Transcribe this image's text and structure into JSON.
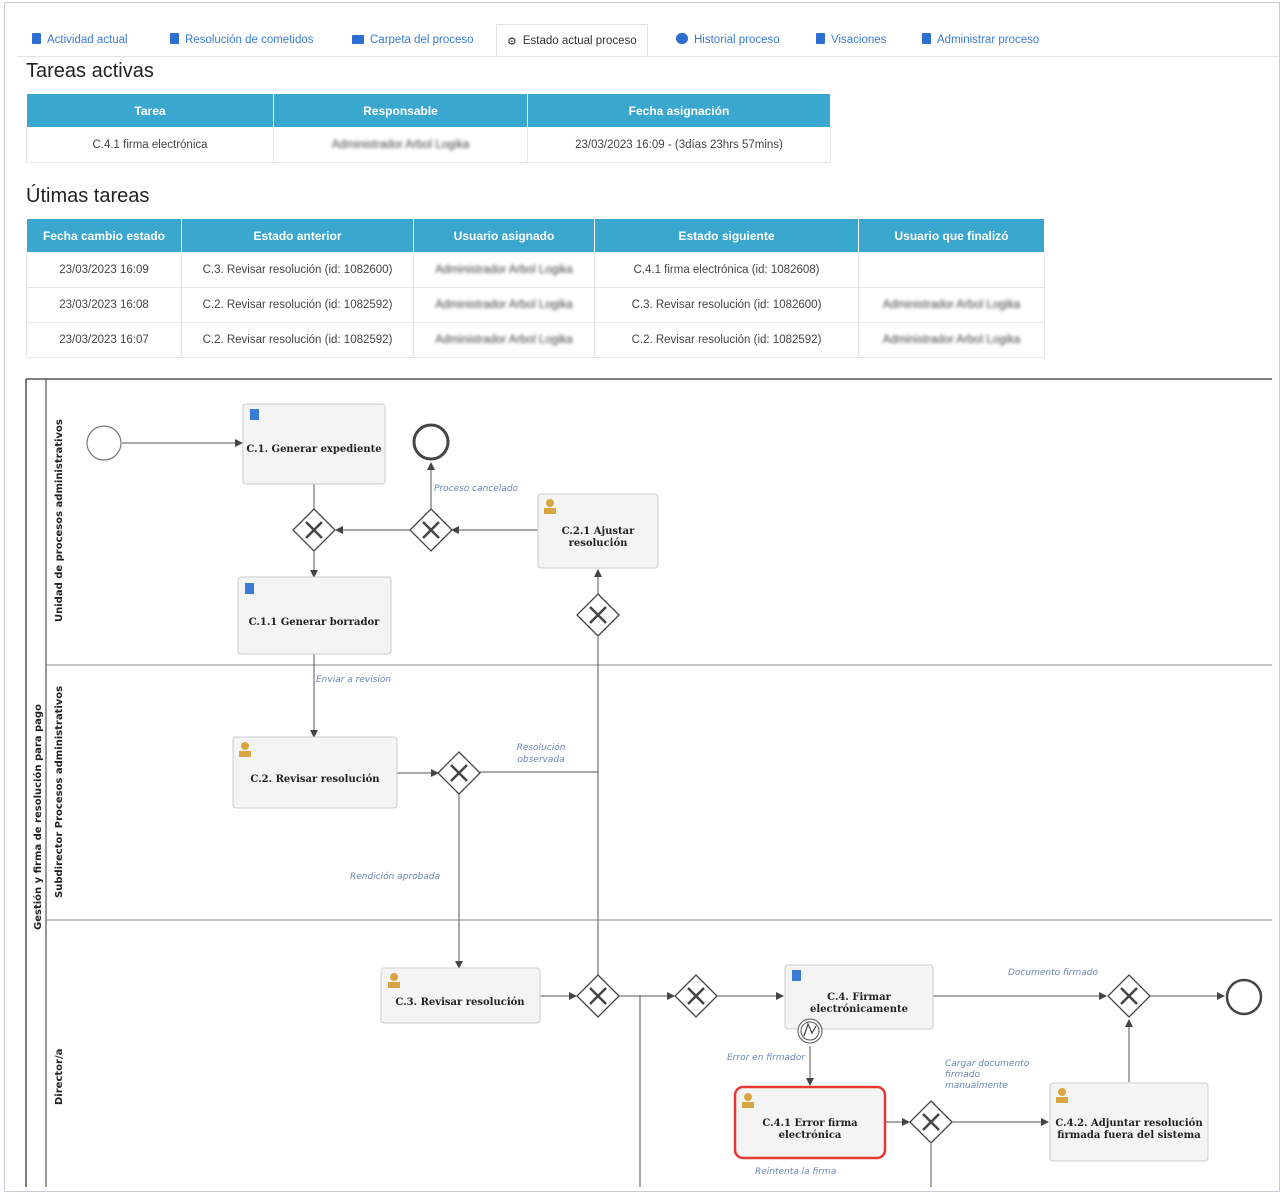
{
  "tabs": [
    {
      "label": "Actividad actual",
      "icon": "list-icon",
      "active": false
    },
    {
      "label": "Resolución de cometidos",
      "icon": "document-icon",
      "active": false
    },
    {
      "label": "Carpeta del proceso",
      "icon": "folder-icon",
      "active": false
    },
    {
      "label": "Estado actual proceso",
      "icon": "process-icon",
      "active": true
    },
    {
      "label": "Historial proceso",
      "icon": "history-icon",
      "active": false
    },
    {
      "label": "Visaciones",
      "icon": "edit-icon",
      "active": false
    },
    {
      "label": "Administrar proceso",
      "icon": "document-icon",
      "active": false
    }
  ],
  "active_tasks": {
    "title": "Tareas activas",
    "headers": [
      "Tarea",
      "Responsable",
      "Fecha asignación"
    ],
    "rows": [
      [
        "C.4.1 firma electrónica",
        "Administrador Arbol Logika",
        "23/03/2023 16:09 - (3días 23hrs 57mins)"
      ]
    ]
  },
  "last_tasks": {
    "title": "Útimas tareas",
    "headers": [
      "Fecha cambio estado",
      "Estado anterior",
      "Usuario asignado",
      "Estado siguiente",
      "Usuario que finalizó"
    ],
    "rows": [
      [
        "23/03/2023 16:09",
        "C.3. Revisar resolución (id: 1082600)",
        "Administrador Arbol Logika",
        "C.4.1 firma electrónica (id: 1082608)",
        ""
      ],
      [
        "23/03/2023 16:08",
        "C.2. Revisar resolución (id: 1082592)",
        "Administrador Arbol Logika",
        "C.3. Revisar resolución (id: 1082600)",
        "Administrador Arbol Logika"
      ],
      [
        "23/03/2023 16:07",
        "C.2. Revisar resolución (id: 1082592)",
        "Administrador Arbol Logika",
        "C.2. Revisar resolución (id: 1082592)",
        "Administrador Arbol Logika"
      ]
    ]
  },
  "diagram": {
    "pool_label": "Gestión y firma de resolución para pago",
    "lanes": [
      "Unidad de procesos administrativos",
      "Subdirector Procesos administrativos",
      "Director/a"
    ],
    "tasks": {
      "c1": "C.1. Generar expediente",
      "c11": "C.1.1 Generar borrador",
      "c21a": "C.2.1 Ajustar",
      "c21b": "resolución",
      "c2": "C.2. Revisar resolución",
      "c3": "C.3. Revisar resolución",
      "c4a": "C.4. Firmar",
      "c4b": "electrónicamente",
      "c41a": "C.4.1 Error firma",
      "c41b": "electrónica",
      "c42a": "C.4.2. Adjuntar resolución",
      "c42b": "firmada fuera del sistema"
    },
    "flows": {
      "cancel": "Proceso cancelado",
      "send_review": "Enviar a revisión",
      "observed_a": "Resolución",
      "observed_b": "observada",
      "approved": "Rendición aprobada",
      "signed": "Documento firmado",
      "signer_error": "Error en firmador",
      "upload_a": "Cargar documento",
      "upload_b": "firmado",
      "upload_c": "manualmente",
      "retry": "Reintenta la firma"
    },
    "colors": {
      "active_task": "#e53935",
      "task_icon": "#3a7bd5",
      "user_icon": "#d9a441"
    }
  }
}
